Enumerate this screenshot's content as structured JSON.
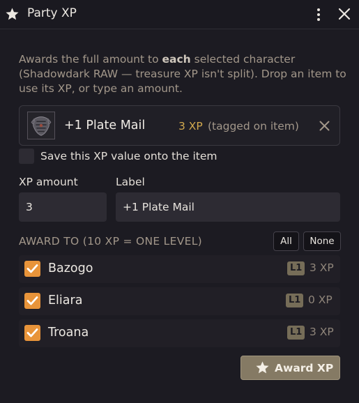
{
  "window": {
    "title": "Party XP",
    "icons": {
      "title": "star-icon",
      "menu": "kebab-icon",
      "close": "close-icon"
    }
  },
  "description": {
    "part1": "Awards the full amount to ",
    "bold": "each",
    "part2": " selected character (Shadowdark RAW — treasure XP isn't split). Drop an item to use its XP, or type an amount."
  },
  "item": {
    "name": "+1 Plate Mail",
    "xp": "3 XP",
    "tag": "(tagged on item)",
    "icons": {
      "image": "plate-mail-armor-icon",
      "remove": "remove-icon"
    }
  },
  "save_option": {
    "label": "Save this XP value onto the item",
    "checked": false
  },
  "form": {
    "xp_label": "XP amount",
    "xp_value": "3",
    "label_label": "Label",
    "label_value": "+1 Plate Mail"
  },
  "award": {
    "heading": "AWARD TO (10 XP = ONE LEVEL)",
    "all_label": "All",
    "none_label": "None"
  },
  "characters": [
    {
      "name": "Bazogo",
      "level": "L1",
      "xp": "3 XP",
      "checked": true
    },
    {
      "name": "Eliara",
      "level": "L1",
      "xp": "0 XP",
      "checked": true
    },
    {
      "name": "Troana",
      "level": "L1",
      "xp": "3 XP",
      "checked": true
    }
  ],
  "award_button": {
    "label": "Award XP",
    "icon": "star-icon"
  },
  "colors": {
    "background": "#1c1b22",
    "accent_orange": "#e8943a",
    "xp_gold": "#d2a94e",
    "button": "#857a64",
    "muted_text": "#a2978a"
  }
}
